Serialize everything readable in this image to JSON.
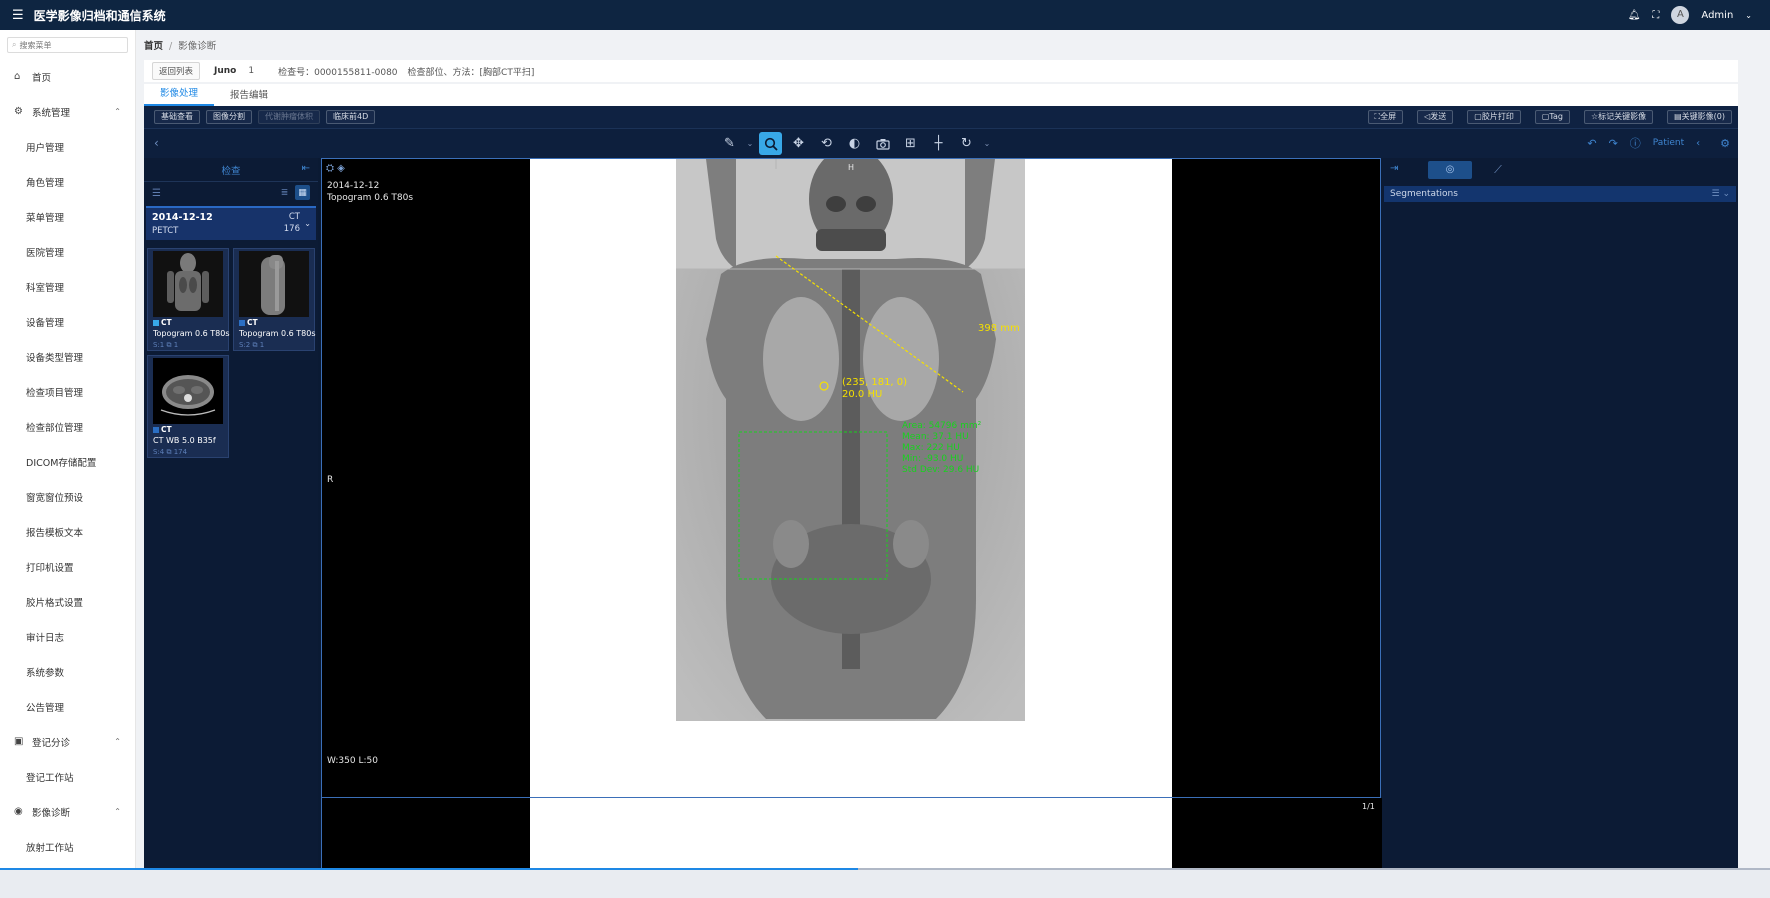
{
  "app": {
    "title": "医学影像归档和通信系统",
    "user": "Admin",
    "avatar_letter": "A"
  },
  "sidebar": {
    "search_placeholder": "搜索菜单",
    "items": [
      {
        "label": "首页",
        "type": "top",
        "icon": "home-icon"
      },
      {
        "label": "系统管理",
        "type": "group",
        "icon": "gear-icon"
      },
      {
        "label": "用户管理",
        "type": "sub"
      },
      {
        "label": "角色管理",
        "type": "sub"
      },
      {
        "label": "菜单管理",
        "type": "sub"
      },
      {
        "label": "医院管理",
        "type": "sub"
      },
      {
        "label": "科室管理",
        "type": "sub"
      },
      {
        "label": "设备管理",
        "type": "sub"
      },
      {
        "label": "设备类型管理",
        "type": "sub"
      },
      {
        "label": "检查项目管理",
        "type": "sub"
      },
      {
        "label": "检查部位管理",
        "type": "sub"
      },
      {
        "label": "DICOM存储配置",
        "type": "sub"
      },
      {
        "label": "窗宽窗位预设",
        "type": "sub"
      },
      {
        "label": "报告模板文本",
        "type": "sub"
      },
      {
        "label": "打印机设置",
        "type": "sub"
      },
      {
        "label": "胶片格式设置",
        "type": "sub"
      },
      {
        "label": "审计日志",
        "type": "sub"
      },
      {
        "label": "系统参数",
        "type": "sub"
      },
      {
        "label": "公告管理",
        "type": "sub"
      },
      {
        "label": "登记分诊",
        "type": "group",
        "icon": "register-icon"
      },
      {
        "label": "登记工作站",
        "type": "sub"
      },
      {
        "label": "影像诊断",
        "type": "group",
        "icon": "eye-icon"
      },
      {
        "label": "放射工作站",
        "type": "sub"
      }
    ]
  },
  "breadcrumb": {
    "home": "首页",
    "current": "影像诊断"
  },
  "info": {
    "back_label": "返回列表",
    "patient_name": "Juno",
    "patient_num": "1",
    "exam_no": "检查号：0000155811-0080",
    "exam_part": "检查部位、方法：[胸部CT平扫]"
  },
  "tabs": [
    {
      "label": "影像处理",
      "active": true
    },
    {
      "label": "报告编辑",
      "active": false
    }
  ],
  "viewer_toolbar": {
    "left_buttons": [
      {
        "label": "基础查看",
        "disabled": false
      },
      {
        "label": "图像分割",
        "disabled": false
      },
      {
        "label": "代谢肿瘤体积",
        "disabled": true
      },
      {
        "label": "临床前4D",
        "disabled": false
      }
    ],
    "right_buttons": [
      "⛶全屏",
      "◁发送",
      "▢胶片打印",
      "▢Tag",
      "☆标记关键影像",
      "▤关键影像(0)"
    ],
    "patient_label": "Patient"
  },
  "left_panel": {
    "header": "检查",
    "study": {
      "date": "2014-12-12",
      "modality": "PETCT",
      "type": "CT",
      "count": "176"
    },
    "series": [
      {
        "modality": "CT",
        "desc": "Topogram 0.6 T80s",
        "meta": "S:1  ⧉ 1"
      },
      {
        "modality": "CT",
        "desc": "Topogram 0.6 T80s",
        "meta": "S:2  ⧉ 1"
      },
      {
        "modality": "CT",
        "desc": "CT WB 5.0 B35f",
        "meta": "S:4  ⧉ 174"
      }
    ]
  },
  "viewport": {
    "date": "2014-12-12",
    "series": "Topogram 0.6 T80s",
    "orient_left": "R",
    "orient_top": "H",
    "wl": "W:350  L:50",
    "frame": "1/1",
    "measure_length": "398 mm",
    "probe_coords": "(235, 181, 0)",
    "probe_hu": "20.0 HU",
    "roi": [
      "Area: 54796 mm²",
      "Mean: 37.1 HU",
      "Max: 222 HU",
      "Min: -93.0 HU",
      "Std Dev: 29.6 HU"
    ]
  },
  "right_panel": {
    "segmentations_label": "Segmentations"
  }
}
